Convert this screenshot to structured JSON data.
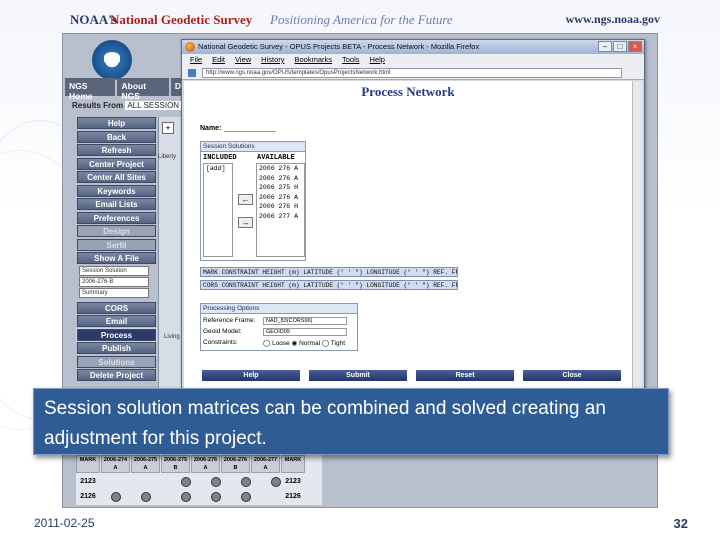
{
  "header": {
    "noaa": "NOAA's",
    "ngs": "National Geodetic Survey",
    "tagline": "Positioning America for the Future",
    "url": "www.ngs.noaa.gov"
  },
  "ngs_nav": {
    "tabs": [
      "NGS Home",
      "About NGS",
      "D"
    ],
    "results_label": "Results From",
    "results_value": "ALL SESSION SOLU"
  },
  "left_nav": {
    "buttons_top": [
      "Help",
      "Back",
      "Refresh",
      "Center Project",
      "Center All Sites",
      "Keywords",
      "Email Lists",
      "Preferences",
      "Design",
      "Serfil",
      "Show A File"
    ],
    "selects": [
      "Session Solution",
      "2006-276-B",
      "Summary"
    ],
    "buttons_bottom": [
      "CORS",
      "Email",
      "Process",
      "Publish",
      "Solutions",
      "Delete Project"
    ]
  },
  "map": {
    "zoom_label": "+",
    "label1": "Liberty",
    "label2": "Living"
  },
  "browser": {
    "title": "National Geodetic Survey - OPUS Projects BETA - Process Network - Mozilla Firefox",
    "menu": [
      "File",
      "Edit",
      "View",
      "History",
      "Bookmarks",
      "Tools",
      "Help"
    ],
    "address": "http://www.ngs.noaa.gov/OPUS/templates/OpusProjectsNetwork.html"
  },
  "process_network": {
    "title": "Process Network",
    "name_label": "Name:",
    "session_box_title": "Session Solutions",
    "included_header": "INCLUDED",
    "available_header": "AVAILABLE",
    "included_items": [
      "[add]"
    ],
    "available_items": [
      "2006 276 A",
      "2006 276 A",
      "2006 275 H",
      "2006 276 A",
      "2006 276 H",
      "2006 277 A"
    ],
    "arrow_left": "←",
    "arrow_right": "→",
    "mark_header": "MARK  CONSTRAINT  HEIGHT (m)  LATITUDE (° ' \")  LONGITUDE (° ' \")  REF. FRAME",
    "cors_header": "CORS  CONSTRAINT  HEIGHT (m)  LATITUDE (° ' \")  LONGITUDE (° ' \")  REF. FRAME",
    "processing_title": "Processing Options",
    "ref_frame_label": "Reference Frame:",
    "ref_frame_value": "NAD_83(CORS96)",
    "geoid_label": "Geoid Model:",
    "geoid_value": "GEOID09",
    "constraints_label": "Constraints:",
    "constraints_value": "◯ Loose  ◉ Normal  ◯ Tight",
    "buttons": [
      "Help",
      "Submit",
      "Reset",
      "Close"
    ]
  },
  "grid": {
    "headers": [
      "MARK",
      "2006-274 A",
      "2006-275 A",
      "2006-275 B",
      "2006-276 A",
      "2006-276 B",
      "2006-277 A",
      "MARK"
    ],
    "rows": [
      "2123",
      "2126"
    ]
  },
  "caption": "Session solution matrices can be combined and solved creating an adjustment for this project.",
  "footer": {
    "date": "2011-02-25",
    "page": "32"
  }
}
